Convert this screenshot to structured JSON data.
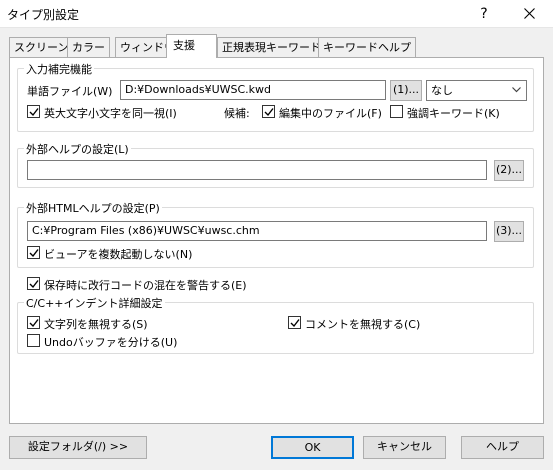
{
  "window": {
    "title": "タイプ別設定",
    "help_glyph": "?"
  },
  "tabs": [
    {
      "label": "スクリーン"
    },
    {
      "label": "カラー"
    },
    {
      "label": "ウィンドウ"
    },
    {
      "label": "支援",
      "active": true
    },
    {
      "label": "正規表現キーワード"
    },
    {
      "label": "キーワードヘルプ"
    }
  ],
  "input_completion": {
    "title": "入力補完機能",
    "word_file_label": "単語ファイル(W)",
    "word_file_value": "D:¥Downloads¥UWSC.kwd",
    "browse_label": "(1)...",
    "mode_value": "なし",
    "ignore_case": {
      "label": "英大文字小文字を同一視(I)",
      "checked": true
    },
    "candidates_label": "候補:",
    "editing_file": {
      "label": "編集中のファイル(F)",
      "checked": true
    },
    "highlight_keywords": {
      "label": "強調キーワード(K)",
      "checked": false
    }
  },
  "external_help": {
    "title": "外部ヘルプの設定(L)",
    "value": "",
    "browse_label": "(2)..."
  },
  "external_html_help": {
    "title": "外部HTMLヘルプの設定(P)",
    "value": "C:¥Program Files (x86)¥UWSC¥uwsc.chm",
    "browse_label": "(3)...",
    "multi_viewer": {
      "label": "ビューアを複数起動しない(N)",
      "checked": true
    }
  },
  "warn_mixed_newline": {
    "label": "保存時に改行コードの混在を警告する(E)",
    "checked": true
  },
  "cpp_indent": {
    "title": "C/C++インデント詳細設定",
    "ignore_strings": {
      "label": "文字列を無視する(S)",
      "checked": true
    },
    "ignore_comments": {
      "label": "コメントを無視する(C)",
      "checked": true
    },
    "split_undo": {
      "label": "Undoバッファを分ける(U)",
      "checked": false
    }
  },
  "buttons": {
    "settings_folder": "設定フォルダ(/) >>",
    "ok": "OK",
    "cancel": "キャンセル",
    "help": "ヘルプ"
  }
}
